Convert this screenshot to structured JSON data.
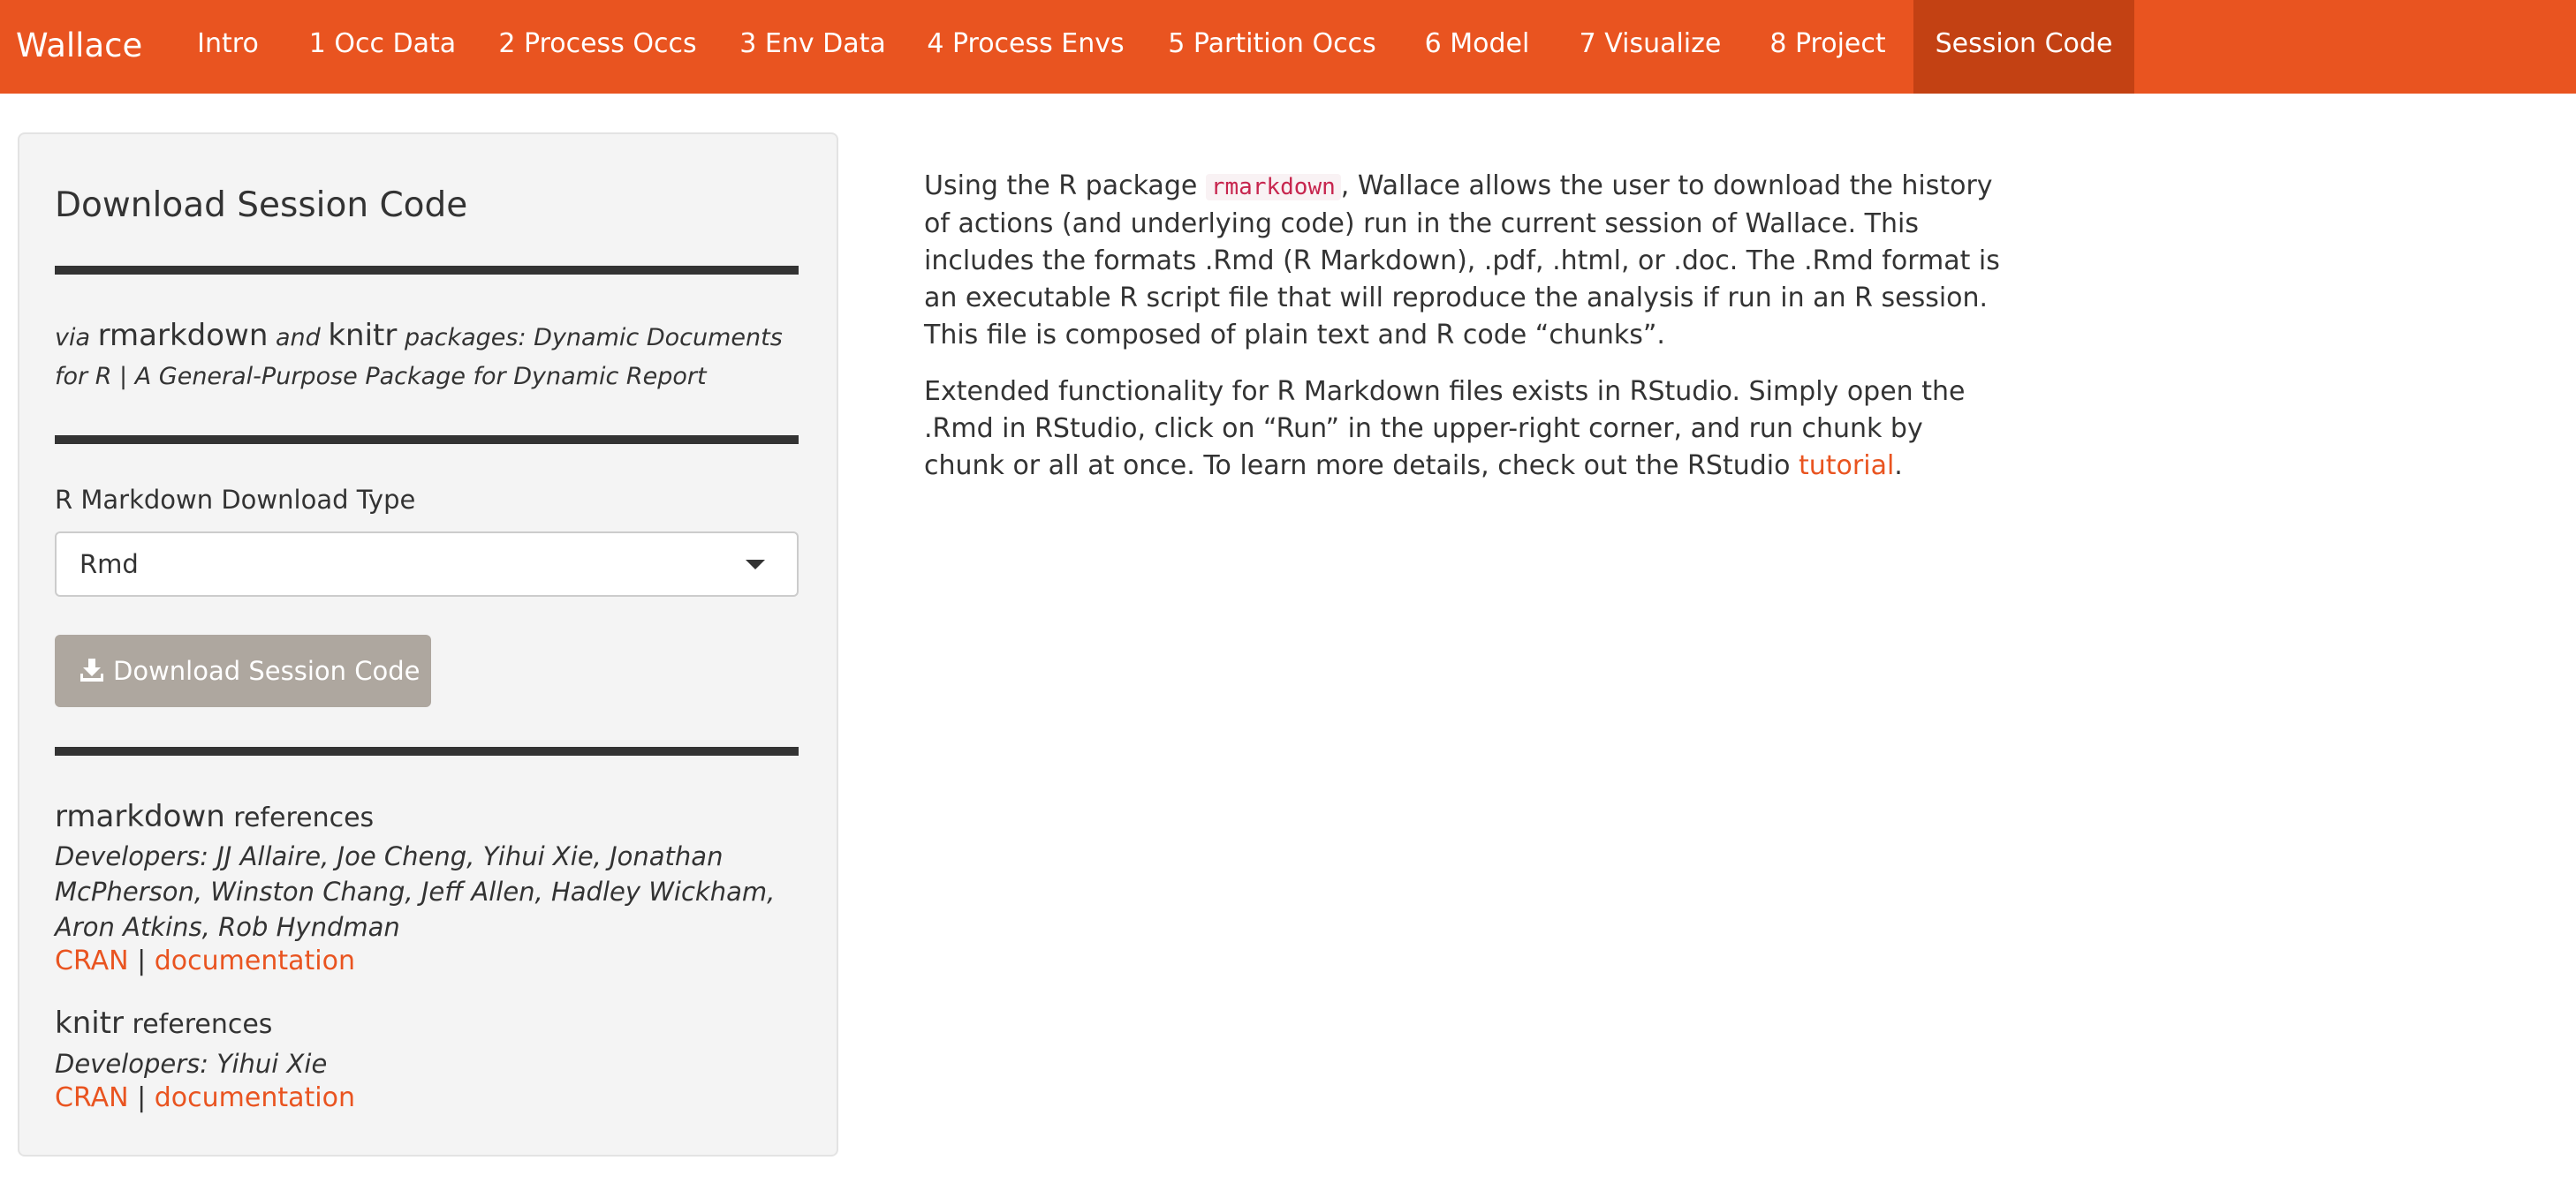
{
  "navbar": {
    "brand": "Wallace",
    "items": [
      {
        "label": "Intro"
      },
      {
        "label": "1 Occ Data"
      },
      {
        "label": "2 Process Occs"
      },
      {
        "label": "3 Env Data"
      },
      {
        "label": "4 Process Envs"
      },
      {
        "label": "5 Partition Occs"
      },
      {
        "label": "6 Model"
      },
      {
        "label": "7 Visualize"
      },
      {
        "label": "8 Project"
      },
      {
        "label": "Session Code"
      }
    ],
    "active": "Session Code"
  },
  "sidebar": {
    "title": "Download Session Code",
    "via": {
      "prefix": "via",
      "pkg1": "rmarkdown",
      "and": "and",
      "pkg2": "knitr",
      "suffix": "packages: Dynamic Documents for R | A General-Purpose Package for Dynamic Report"
    },
    "select_label": "R Markdown Download Type",
    "select_value": "Rmd",
    "download_button": "Download Session Code",
    "refs": [
      {
        "pkg": "rmarkdown",
        "word": "references",
        "developers": "Developers: JJ Allaire, Joe Cheng, Yihui Xie, Jonathan McPherson, Winston Chang, Jeff Allen, Hadley Wickham, Aron Atkins, Rob Hyndman",
        "cran": "CRAN",
        "sep": "|",
        "docs": "documentation"
      },
      {
        "pkg": "knitr",
        "word": "references",
        "developers": "Developers: Yihui Xie",
        "cran": "CRAN",
        "sep": "|",
        "docs": "documentation"
      }
    ]
  },
  "main": {
    "p1": {
      "before": "Using the R package",
      "code": "rmarkdown",
      "after": ", Wallace allows the user to download the history of actions (and underlying code) run in the current session of Wallace. This includes the formats .Rmd (R Markdown), .pdf, .html, or .doc. The .Rmd format is an executable R script file that will reproduce the analysis if run in an R session. This file is composed of plain text and R code “chunks”."
    },
    "p2": {
      "before": "Extended functionality for R Markdown files exists in RStudio. Simply open the .Rmd in RStudio, click on “Run” in the upper-right corner, and run chunk by chunk or all at once. To learn more details, check out the RStudio",
      "link": "tutorial",
      "after": "."
    }
  },
  "colors": {
    "brand": "#e95420",
    "active_tab": "#c34113",
    "button": "#aea79f",
    "link": "#e95420"
  }
}
